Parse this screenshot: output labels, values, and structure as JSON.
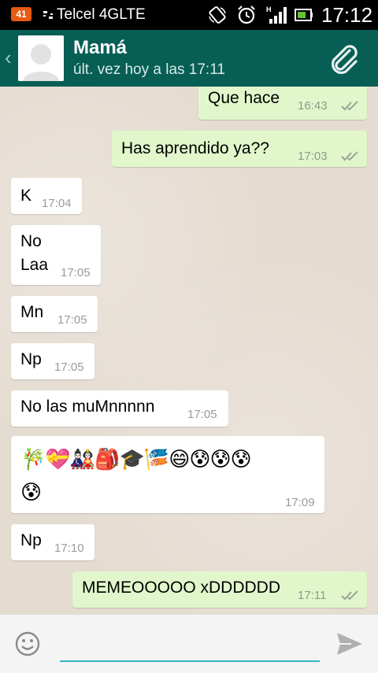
{
  "status_bar": {
    "notification_count": "41",
    "carrier": "Telcel 4GLTE",
    "network_type": "H",
    "time": "17:12"
  },
  "header": {
    "contact_name": "Mamá",
    "last_seen": "últ. vez hoy a las 17:11"
  },
  "messages": [
    {
      "direction": "outgoing",
      "text": "Que hace",
      "time": "16:43",
      "status": "read"
    },
    {
      "direction": "outgoing",
      "text": "Has aprendido ya??",
      "time": "17:03",
      "status": "read"
    },
    {
      "direction": "incoming",
      "text": "K",
      "time": "17:04"
    },
    {
      "direction": "incoming",
      "text": "No\nLaa",
      "time": "17:05"
    },
    {
      "direction": "incoming",
      "text": "Mn",
      "time": "17:05"
    },
    {
      "direction": "incoming",
      "text": "Np",
      "time": "17:05"
    },
    {
      "direction": "incoming",
      "text": "No las muMnnnnn",
      "time": "17:05"
    },
    {
      "direction": "incoming",
      "text": "🎋💝🎎🎒🎓🎏😄😰😰😰\n😰",
      "time": "17:09"
    },
    {
      "direction": "incoming",
      "text": "Np",
      "time": "17:10"
    },
    {
      "direction": "outgoing",
      "text": "MEMEOOOOO xDDDDDD",
      "time": "17:11",
      "status": "read"
    }
  ],
  "composer": {
    "text_value": "",
    "emoji_icon": "smiley-icon",
    "send_icon": "send-icon"
  },
  "colors": {
    "header": "#075e55",
    "outgoing_bubble": "#e1f7cb",
    "incoming_bubble": "#ffffff",
    "input_underline": "#33b5c8"
  }
}
